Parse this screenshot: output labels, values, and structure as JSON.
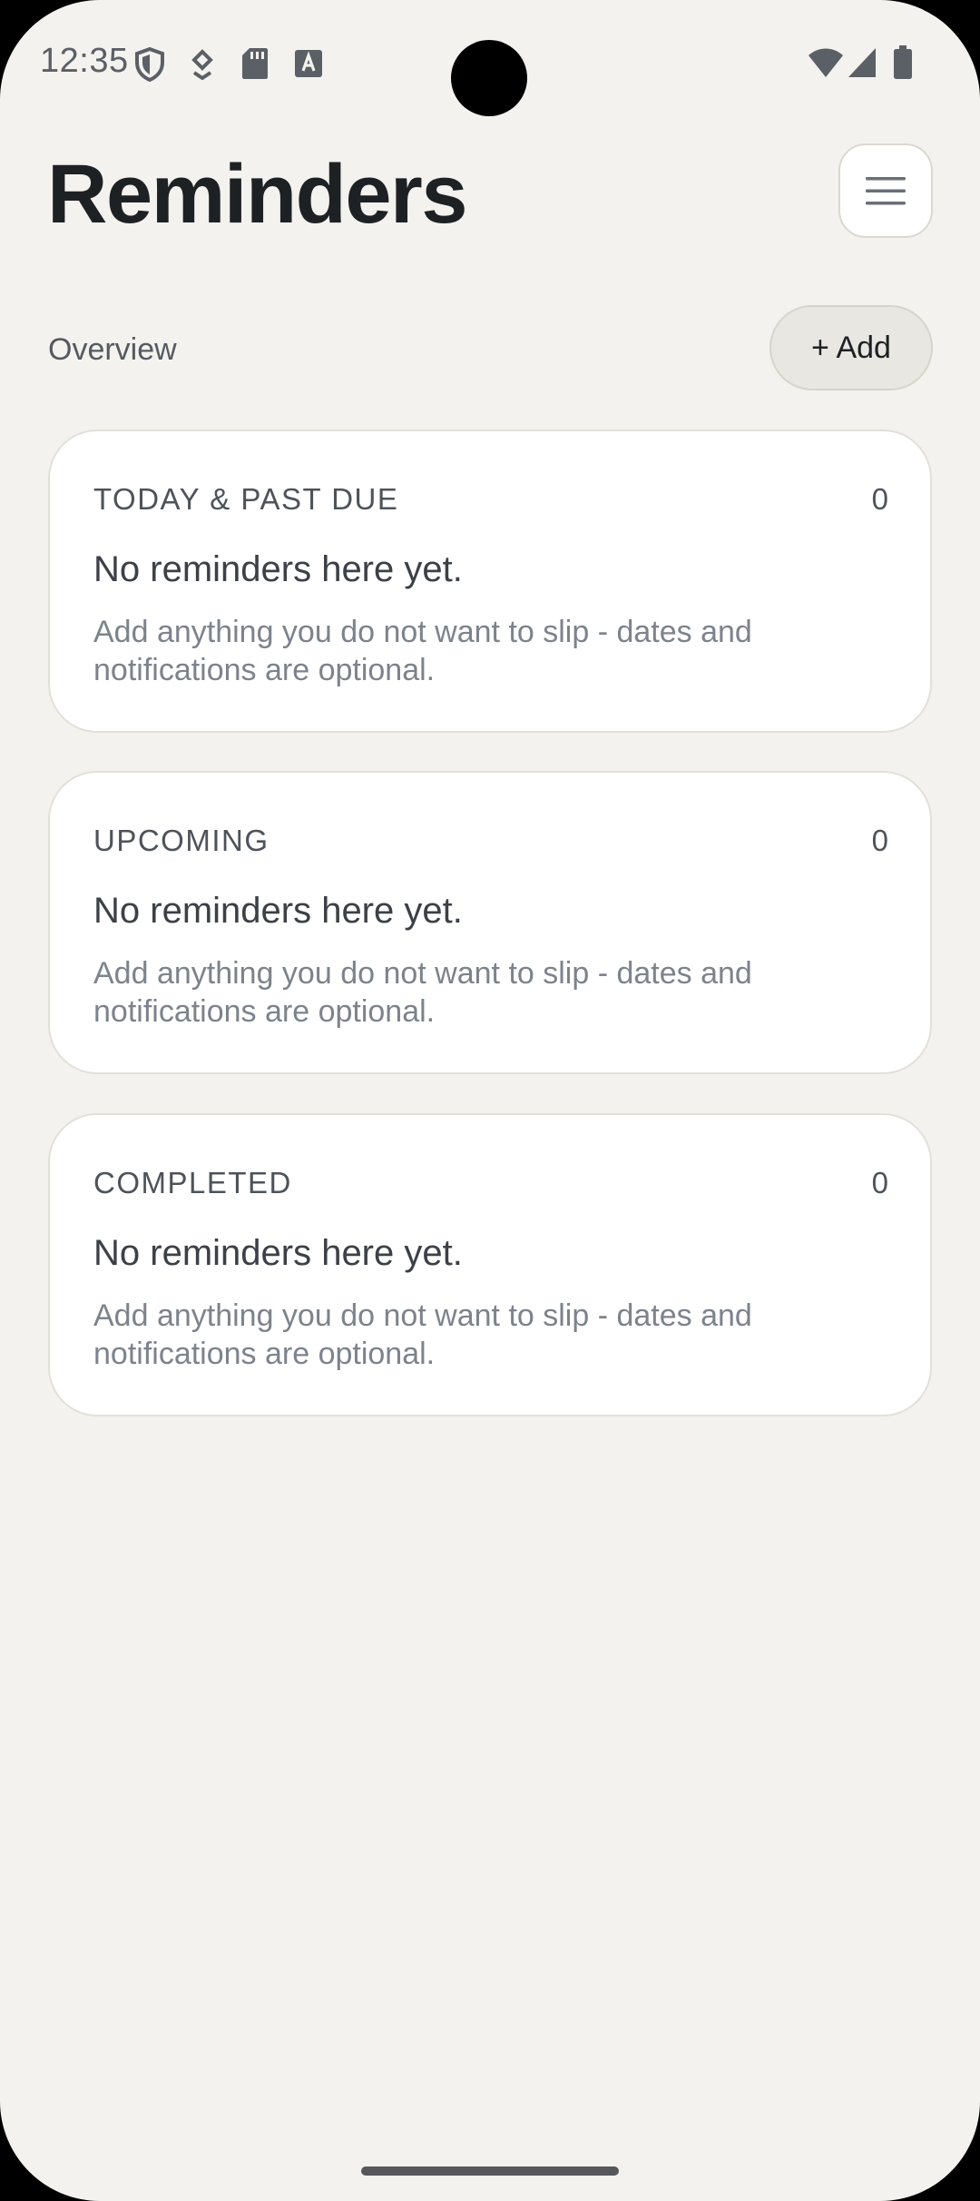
{
  "status_bar": {
    "time": "12:35",
    "left_icons": [
      "shield-icon",
      "download-icon",
      "sd-card-icon",
      "font-a-icon"
    ],
    "right_icons": [
      "wifi-icon",
      "cell-signal-icon",
      "battery-icon"
    ]
  },
  "header": {
    "title": "Reminders",
    "menu_icon": "hamburger-menu-icon"
  },
  "toolbar": {
    "overview_label": "Overview",
    "add_label": "+ Add"
  },
  "sections": [
    {
      "title": "TODAY & PAST DUE",
      "count": "0",
      "empty_text": "No reminders here yet.",
      "hint_text": "Add anything you do not want to slip - dates and notifications are optional."
    },
    {
      "title": "UPCOMING",
      "count": "0",
      "empty_text": "No reminders here yet.",
      "hint_text": "Add anything you do not want to slip - dates and notifications are optional."
    },
    {
      "title": "COMPLETED",
      "count": "0",
      "empty_text": "No reminders here yet.",
      "hint_text": "Add anything you do not want to slip - dates and notifications are optional."
    }
  ],
  "colors": {
    "background": "#f4f2ee",
    "card": "#ffffff",
    "title_text": "#1e2124",
    "muted_text": "#7d838c"
  }
}
